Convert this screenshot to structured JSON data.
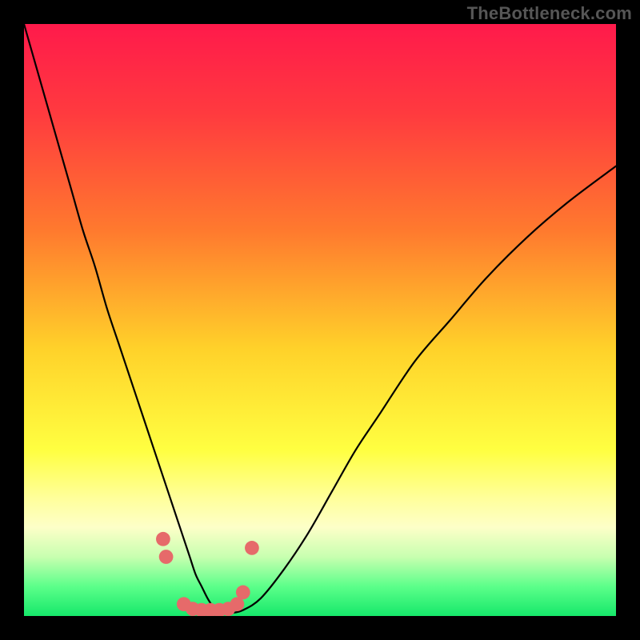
{
  "watermark": "TheBottleneck.com",
  "chart_data": {
    "type": "line",
    "title": "",
    "xlabel": "",
    "ylabel": "",
    "xlim": [
      0,
      100
    ],
    "ylim": [
      0,
      100
    ],
    "background_gradient": {
      "stops": [
        {
          "offset": 0.0,
          "color": "#ff1a4b"
        },
        {
          "offset": 0.15,
          "color": "#ff3a3f"
        },
        {
          "offset": 0.35,
          "color": "#ff7a2e"
        },
        {
          "offset": 0.55,
          "color": "#ffd22a"
        },
        {
          "offset": 0.72,
          "color": "#ffff41"
        },
        {
          "offset": 0.8,
          "color": "#ffff9a"
        },
        {
          "offset": 0.85,
          "color": "#fdffc8"
        },
        {
          "offset": 0.9,
          "color": "#c8ffb0"
        },
        {
          "offset": 0.95,
          "color": "#5cff8a"
        },
        {
          "offset": 1.0,
          "color": "#16e86a"
        }
      ]
    },
    "series": [
      {
        "name": "curve",
        "x": [
          0,
          2,
          4,
          6,
          8,
          10,
          12,
          14,
          16,
          18,
          20,
          22,
          24,
          25,
          26,
          27,
          28,
          29,
          30,
          31,
          32,
          33,
          34,
          35,
          37,
          40,
          44,
          48,
          52,
          56,
          60,
          66,
          72,
          78,
          85,
          92,
          100
        ],
        "y": [
          100,
          93,
          86,
          79,
          72,
          65,
          59,
          52,
          46,
          40,
          34,
          28,
          22,
          19,
          16,
          13,
          10,
          7,
          5,
          3,
          1.5,
          0.8,
          0.5,
          0.5,
          1,
          3,
          8,
          14,
          21,
          28,
          34,
          43,
          50,
          57,
          64,
          70,
          76
        ]
      }
    ],
    "markers": {
      "color": "#e66a6a",
      "radius_pct": 1.2,
      "points": [
        {
          "x": 23.5,
          "y": 13
        },
        {
          "x": 24.0,
          "y": 10
        },
        {
          "x": 27.0,
          "y": 2.0
        },
        {
          "x": 28.5,
          "y": 1.2
        },
        {
          "x": 30.0,
          "y": 1.0
        },
        {
          "x": 31.5,
          "y": 1.0
        },
        {
          "x": 33.0,
          "y": 1.0
        },
        {
          "x": 34.5,
          "y": 1.2
        },
        {
          "x": 36.0,
          "y": 2.0
        },
        {
          "x": 37.0,
          "y": 4.0
        },
        {
          "x": 38.5,
          "y": 11.5
        }
      ]
    }
  }
}
